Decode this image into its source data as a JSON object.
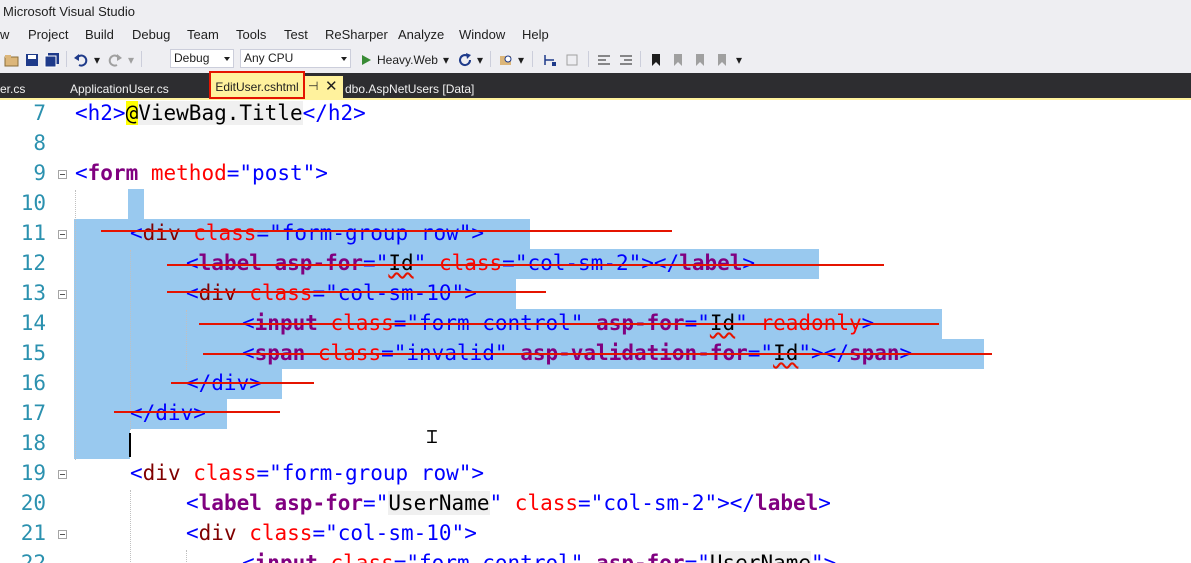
{
  "window": {
    "title": "Microsoft Visual Studio"
  },
  "menu": [
    "w",
    "Project",
    "Build",
    "Debug",
    "Team",
    "Tools",
    "Test",
    "ReSharper",
    "Analyze",
    "Window",
    "Help"
  ],
  "toolbar": {
    "config": "Debug",
    "platform": "Any CPU",
    "run_target": "Heavy.Web"
  },
  "tabs": {
    "t0": "er.cs",
    "t1": "ApplicationUser.cs",
    "active": "EditUser.cshtml",
    "t3": "dbo.AspNetUsers [Data]"
  },
  "editor": {
    "lines": [
      {
        "n": "7"
      },
      {
        "n": "8"
      },
      {
        "n": "9"
      },
      {
        "n": "10"
      },
      {
        "n": "11"
      },
      {
        "n": "12"
      },
      {
        "n": "13"
      },
      {
        "n": "14"
      },
      {
        "n": "15"
      },
      {
        "n": "16"
      },
      {
        "n": "17"
      },
      {
        "n": "18"
      },
      {
        "n": "19"
      },
      {
        "n": "20"
      },
      {
        "n": "21"
      },
      {
        "n": "22"
      }
    ],
    "code": {
      "l7_open": "<h2>",
      "l7_razor": "@",
      "l7_expr": "ViewBag.Title",
      "l7_close": "</h2>",
      "l9_a": "<",
      "l9_tag": "form",
      "l9_attr": " method",
      "l9_eq": "=",
      "l9_val": "\"post\"",
      "l9_close": ">",
      "l11_a": "<",
      "l11_tag": "div",
      "l11_attr": " class",
      "l11_eq": "=",
      "l11_val": "\"form-group row\"",
      "l11_close": ">",
      "l12_a": "<",
      "l12_tag": "label",
      "l12_attr1": " asp-for",
      "l12_eq1": "=",
      "l12_q1": "\"",
      "l12_id": "Id",
      "l12_q2": "\"",
      "l12_attr2": " class",
      "l12_eq2": "=",
      "l12_val2": "\"col-sm-2\"",
      "l12_close": "></",
      "l12_tag2": "label",
      "l12_end": ">",
      "l13_a": "<",
      "l13_tag": "div",
      "l13_attr": " class",
      "l13_eq": "=",
      "l13_val": "\"col-sm-10\"",
      "l13_close": ">",
      "l14_a": "<",
      "l14_tag": "input",
      "l14_attr1": " class",
      "l14_eq1": "=",
      "l14_val1": "\"form-control\"",
      "l14_attr2": " asp-for",
      "l14_eq2": "=",
      "l14_q1": "\"",
      "l14_id": "Id",
      "l14_q2": "\"",
      "l14_attr3": " readonly",
      "l14_close": ">",
      "l15_a": "<",
      "l15_tag": "span",
      "l15_attr1": " class",
      "l15_eq1": "=",
      "l15_val1": "\"invalid\"",
      "l15_attr2": " asp-validation-for",
      "l15_eq2": "=",
      "l15_q1": "\"",
      "l15_id": "Id",
      "l15_q2": "\"",
      "l15_close": "></",
      "l15_tag2": "span",
      "l15_end": ">",
      "l16": "</div>",
      "l17": "</div>",
      "l19_a": "<",
      "l19_tag": "div",
      "l19_attr": " class",
      "l19_eq": "=",
      "l19_val": "\"form-group row\"",
      "l19_close": ">",
      "l20_a": "<",
      "l20_tag": "label",
      "l20_attr1": " asp-for",
      "l20_eq1": "=",
      "l20_q1": "\"",
      "l20_id": "UserName",
      "l20_q2": "\"",
      "l20_attr2": " class",
      "l20_eq2": "=",
      "l20_val2": "\"col-sm-2\"",
      "l20_close": "></",
      "l20_tag2": "label",
      "l20_end": ">",
      "l21_a": "<",
      "l21_tag": "div",
      "l21_attr": " class",
      "l21_eq": "=",
      "l21_val": "\"col-sm-10\"",
      "l21_close": ">",
      "l22_a": "<",
      "l22_tag": "input",
      "l22_attr1": " class",
      "l22_eq1": "=",
      "l22_val1": "\"form-control\"",
      "l22_attr2": " asp-for",
      "l22_eq2": "=",
      "l22_q1": "\"",
      "l22_id": "UserName",
      "l22_q2": "\">"
    }
  },
  "colors": {
    "accent": "#e51400",
    "selection": "#99c9ef",
    "active_tab": "#fff29d"
  }
}
